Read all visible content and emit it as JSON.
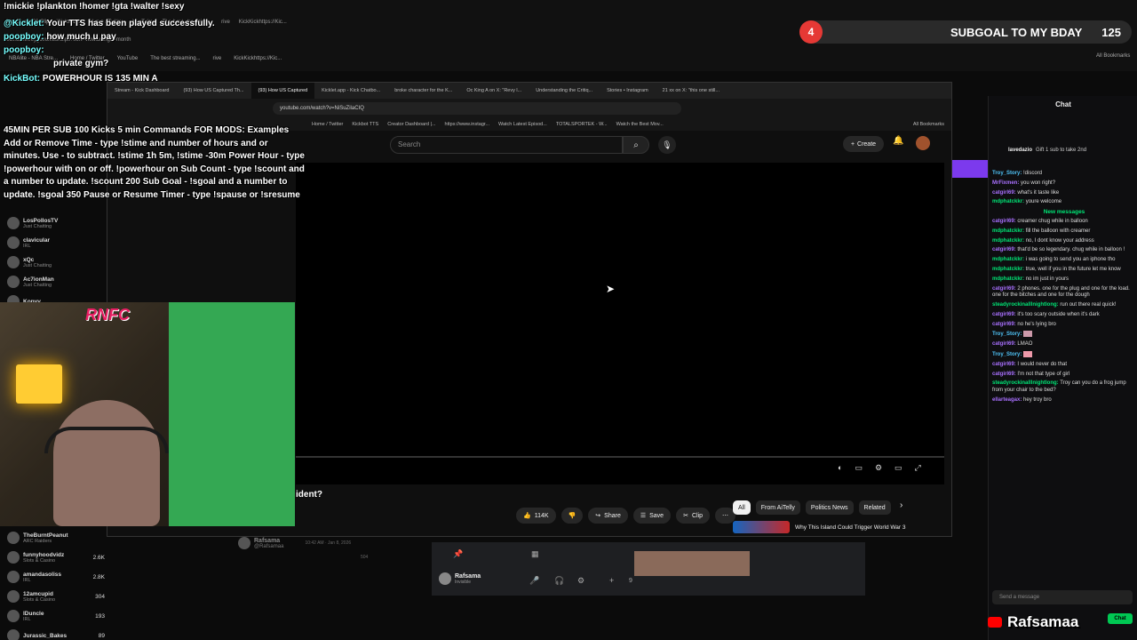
{
  "back_browser": {
    "tabs": [
      "TroyGovoni68 Clips - Watch L...",
      "Home / Twitter",
      "YouTube",
      "The best streaming...",
      "rive",
      "KickKickhttps://Kic..."
    ],
    "url": "kick.com/troygovoni68/clips?sort=view&range=month",
    "bookmarks": [
      "NBAlite - NBA Stre...",
      "Home / Twitter",
      "YouTube",
      "The best streaming...",
      "rive",
      "KickKickhttps://Kic..."
    ],
    "all_bookmarks": "All Bookmarks"
  },
  "overlay": {
    "line1": "!mickie !plankton !homer !gta !walter !sexy",
    "tts_user": "@Kicklet:",
    "tts_text": "Your TTS has been played successfully.",
    "msg1_user": "poopboy:",
    "msg1_text": "how much u pay",
    "msg2_user": "poopboy:",
    "msg3_text": "private gym?",
    "kicklet_user": "KickBot:",
    "commands": "45MIN PER SUB 100 Kicks 5 min Commands FOR MODS: Examples Add or Remove Time - type !stime and number of hours and or minutes. Use - to subtract. !stime 1h 5m, !stime -30m Power Hour - type !powerhour with on or off. !powerhour on Sub Count - type !scount and a number to update. !scount 200 Sub Goal - !sgoal and a number to update. !sgoal 350 Pause or Resume Timer - type !spause or !sresume",
    "powerhour": "POWERHOUR IS 135 MIN A"
  },
  "subgoal": {
    "number": "4",
    "text": "SUBGOAL TO MY BDAY",
    "count": "125"
  },
  "yt": {
    "tabs": [
      "Stream - Kick Dashboard",
      "(93) How US Captured Th...",
      "(93) How US Captured",
      "Kicklet.app - Kick Chatbo...",
      "broke character for the K...",
      "Oc King A on X: \"Revy l...",
      "Understanding the Critiq...",
      "Stories • Instagram",
      "21 xx on X: \"this one still..."
    ],
    "url": "youtube.com/watch?v=NiSuZilaCIQ",
    "bookmarks": [
      "Home / Twitter",
      "Kickbot TTS",
      "Creator Dashboard |...",
      "https://www.instagr...",
      "Watch Latest Episod...",
      "TOTALSPORTEK - W...",
      "Watch the Best Mov..."
    ],
    "all_bookmarks": "All Bookmarks",
    "search_placeholder": "Search",
    "create": "Create",
    "title_tail": "ident?",
    "likes": "114K",
    "share": "Share",
    "save": "Save",
    "clip": "Clip",
    "chips": [
      "All",
      "From AiTelly",
      "Politics News",
      "Related"
    ],
    "rec_title": "Why This Island Could Trigger World War 3"
  },
  "left_sidebar": {
    "items": [
      {
        "name": "LosPollosTV",
        "cat": "Just Chatting"
      },
      {
        "name": "clavicular",
        "cat": "IRL"
      },
      {
        "name": "xQc",
        "cat": "Just Chatting"
      },
      {
        "name": "Ac7ionMan",
        "cat": "Just Chatting"
      },
      {
        "name": "Konvy",
        "cat": ""
      }
    ],
    "bottom": [
      {
        "name": "TheBurntPeanut",
        "cat": "ARC Raiders",
        "count": ""
      },
      {
        "name": "funnyhoodvidz",
        "cat": "Slots & Casino",
        "count": "2.6K"
      },
      {
        "name": "amandasoliss",
        "cat": "IRL",
        "count": "2.8K"
      },
      {
        "name": "12amcupid",
        "cat": "Slots & Casino",
        "count": "304"
      },
      {
        "name": "lDuncle",
        "cat": "IRL",
        "count": "193"
      },
      {
        "name": "Jurassic_Bakes",
        "cat": "",
        "count": "89"
      }
    ]
  },
  "webcam": {
    "sign": "RNFC"
  },
  "tweet": {
    "name": "Rafsama",
    "handle": "@Rafsamaa",
    "time": "10:42 AM · Jan 8, 2026",
    "count": "504"
  },
  "discord": {
    "name": "Rafsama",
    "status": "Invisible",
    "count": "9"
  },
  "chat": {
    "header": "Chat",
    "pinned_user": "lavedazio",
    "pinned_text": "Gift 1 sub to take 2nd",
    "new_messages": "New messages",
    "messages": [
      {
        "user": "Troy_Story:",
        "text": "!discord",
        "c": "o"
      },
      {
        "user": "MrFixmen:",
        "text": "you won right?",
        "c": ""
      },
      {
        "user": "catgirl69:",
        "text": "what's it taste like",
        "c": ""
      },
      {
        "user": "mdphatckkr:",
        "text": "youre welcome",
        "c": "g"
      },
      {
        "user": "catgirl69:",
        "text": "creamer chug while in balloon",
        "c": ""
      },
      {
        "user": "mdphatckkr:",
        "text": "fill the balloon with creamer",
        "c": "g"
      },
      {
        "user": "mdphatckkr:",
        "text": "no, I dont know your address",
        "c": "g"
      },
      {
        "user": "catgirl69:",
        "text": "that'd be so legendary. chug while in balloon !",
        "c": ""
      },
      {
        "user": "mdphatckkr:",
        "text": "i was going to send you an iphone tho",
        "c": "g"
      },
      {
        "user": "mdphatckkr:",
        "text": "true, well if you in the future let me know",
        "c": "g"
      },
      {
        "user": "mdphatckkr:",
        "text": "no im just in yours",
        "c": "g"
      },
      {
        "user": "catgirl69:",
        "text": "2 phones. one for the plug and one for the load. one for the bitches and one for the dough",
        "c": ""
      },
      {
        "user": "steadyrockinalllnightlong:",
        "text": "run out there real quick!",
        "c": "g"
      },
      {
        "user": "catgirl69:",
        "text": "it's too scary outside when it's dark",
        "c": ""
      },
      {
        "user": "catgirl69:",
        "text": "no he's lying bro",
        "c": ""
      },
      {
        "user": "Troy_Story:",
        "text": "",
        "c": "o"
      },
      {
        "user": "catgirl69:",
        "text": "LMAO",
        "c": ""
      },
      {
        "user": "Troy_Story:",
        "text": "",
        "c": "o"
      },
      {
        "user": "catgirl69:",
        "text": "I would never do that",
        "c": ""
      },
      {
        "user": "catgirl69:",
        "text": "I'm not that type of girl",
        "c": ""
      },
      {
        "user": "steadyrockinalllnightlong:",
        "text": "Troy can you do a frog jump from your chair to the bed?",
        "c": "g"
      },
      {
        "user": "ellarteagax:",
        "text": "hey troy bro",
        "c": ""
      }
    ],
    "input_placeholder": "Send a message",
    "send": "Chat"
  },
  "watermark": "Rafsamaa"
}
